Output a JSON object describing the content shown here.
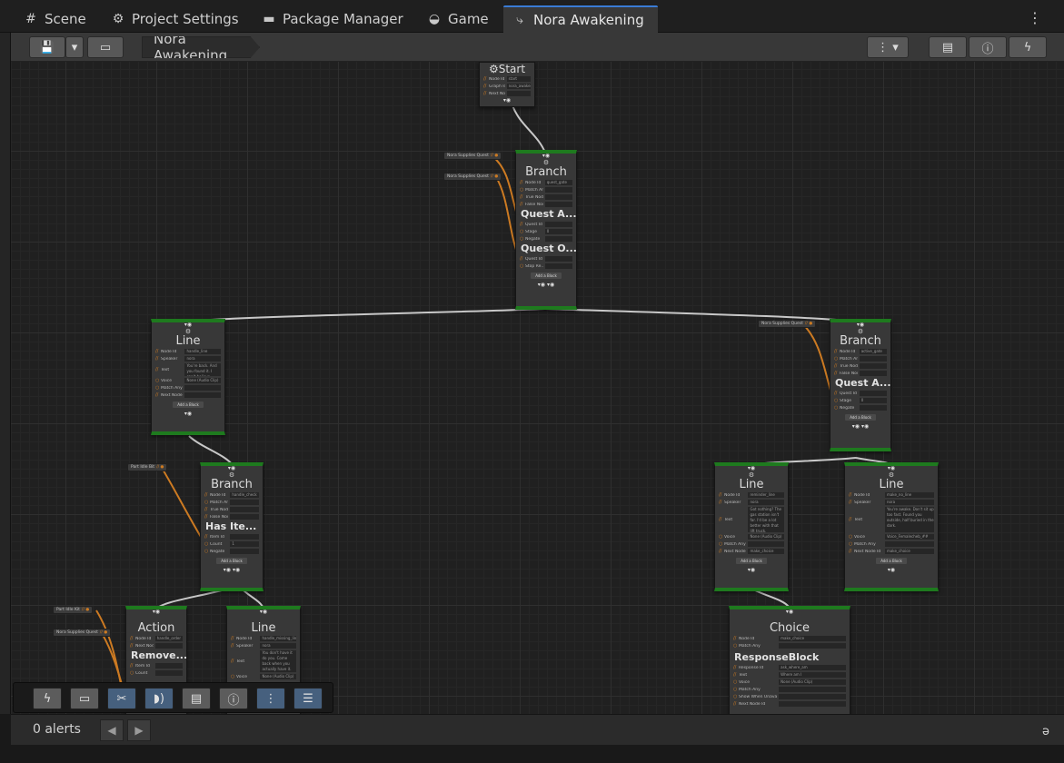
{
  "tabs": [
    {
      "label": "Scene",
      "icon": "grid-icon"
    },
    {
      "label": "Project Settings",
      "icon": "gear-icon"
    },
    {
      "label": "Package Manager",
      "icon": "package-icon"
    },
    {
      "label": "Game",
      "icon": "gamepad-icon"
    },
    {
      "label": "Nora Awakening",
      "icon": "graph-icon",
      "active": true
    }
  ],
  "toolbar": {
    "breadcrumb": "Nora Awakening"
  },
  "nodes": {
    "start": {
      "title": "Start",
      "rows": [
        [
          "Node Id",
          "start"
        ],
        [
          "Graph Id",
          "nora_awakening"
        ],
        [
          "Next Node Id",
          ""
        ]
      ]
    },
    "branch1": {
      "title": "Branch",
      "rows": [
        [
          "Node Id",
          "quest_gate"
        ],
        [
          "Match Any",
          ""
        ],
        [
          "True Node Id",
          ""
        ],
        [
          "False Node Id",
          ""
        ]
      ],
      "sub1": "Quest A...",
      "sub1_rows": [
        [
          "Quest Id",
          ""
        ],
        [
          "Stage",
          "0"
        ],
        [
          "Negate",
          ""
        ]
      ],
      "sub2": "Quest O...",
      "sub2_rows": [
        [
          "Quest Id",
          ""
        ],
        [
          "Stop Re...",
          ""
        ]
      ]
    },
    "line1": {
      "title": "Line",
      "rows": [
        [
          "Node Id",
          "handle_line"
        ],
        [
          "Speaker",
          "nora"
        ],
        [
          "Text",
          "You're back. And you found it. I can't believe..."
        ],
        [
          "Voice",
          "None (Audio Clip)"
        ],
        [
          "Match Any",
          ""
        ],
        [
          "Next Node Id",
          ""
        ]
      ]
    },
    "branch2": {
      "title": "Branch",
      "rows": [
        [
          "Node Id",
          "handle_check"
        ],
        [
          "Match Any",
          ""
        ],
        [
          "True Node Id",
          ""
        ],
        [
          "False Node Id",
          ""
        ]
      ],
      "sub1": "Has Ite...",
      "sub1_rows": [
        [
          "Item Id",
          ""
        ],
        [
          "Count",
          "1"
        ],
        [
          "Negate",
          ""
        ]
      ]
    },
    "branch3": {
      "title": "Branch",
      "rows": [
        [
          "Node Id",
          "active_gate"
        ],
        [
          "Match Any",
          ""
        ],
        [
          "True Node Id",
          ""
        ],
        [
          "False Node Id",
          ""
        ]
      ],
      "sub1": "Quest A...",
      "sub1_rows": [
        [
          "Quest Id",
          ""
        ],
        [
          "Stage",
          "0"
        ],
        [
          "Negate",
          ""
        ]
      ]
    },
    "line2": {
      "title": "Line",
      "rows": [
        [
          "Node Id",
          "reminder_line"
        ],
        [
          "Speaker",
          "nora"
        ],
        [
          "Text",
          "Got nothing? The gas station isn't far. I'd be a lot better with that lift truck."
        ],
        [
          "Voice",
          "None (Audio Clip)"
        ],
        [
          "Match Any",
          ""
        ],
        [
          "Next Node Id",
          "make_choice"
        ]
      ]
    },
    "line3": {
      "title": "Line",
      "rows": [
        [
          "Node Id",
          "make_no_line"
        ],
        [
          "Speaker",
          "nora"
        ],
        [
          "Text",
          "You're awake. Don't sit up too fast. Found you outside, half buried in the dark."
        ],
        [
          "Voice",
          "Voice_Femalecheb_##"
        ],
        [
          "Match Any",
          ""
        ],
        [
          "Next Node Id",
          "make_choice"
        ]
      ]
    },
    "action1": {
      "title": "Action",
      "rows": [
        [
          "Node Id",
          "handle_order"
        ],
        [
          "Next Node Id",
          ""
        ]
      ],
      "sub1": "Remove...",
      "sub1_rows": [
        [
          "Item Id",
          ""
        ],
        [
          "Count",
          ""
        ]
      ]
    },
    "line4": {
      "title": "Line",
      "rows": [
        [
          "Node Id",
          "handle_missing_line"
        ],
        [
          "Speaker",
          "nora"
        ],
        [
          "Text",
          "You don't have it do you. Come back when you actually have it."
        ],
        [
          "Voice",
          "None (Audio Clip)"
        ]
      ]
    },
    "choice1": {
      "title": "Choice",
      "rows": [
        [
          "Node Id",
          "make_choice"
        ],
        [
          "Match Any",
          ""
        ]
      ],
      "sub1": "ResponseBlock",
      "sub1_rows": [
        [
          "Response Id",
          "ask_where_am"
        ],
        [
          "Text",
          "Where am I"
        ],
        [
          "Voice",
          "None (Audio Clip)"
        ],
        [
          "Match Any",
          ""
        ],
        [
          "Show When Unavailable",
          ""
        ],
        [
          "Next Node Id",
          ""
        ]
      ]
    }
  },
  "ext_labels": {
    "e1": "Nora Supplies Quest",
    "e2": "Nora Supplies Quest",
    "e3": "Nora Supplies Quest",
    "e4": "Part Idle Bit",
    "e5": "Part Idle Kit",
    "e6": "Nora Supplies Quest"
  },
  "add_block": "Add a Block",
  "status": {
    "alerts": "0 alerts",
    "bottom_glyph": "ə"
  }
}
